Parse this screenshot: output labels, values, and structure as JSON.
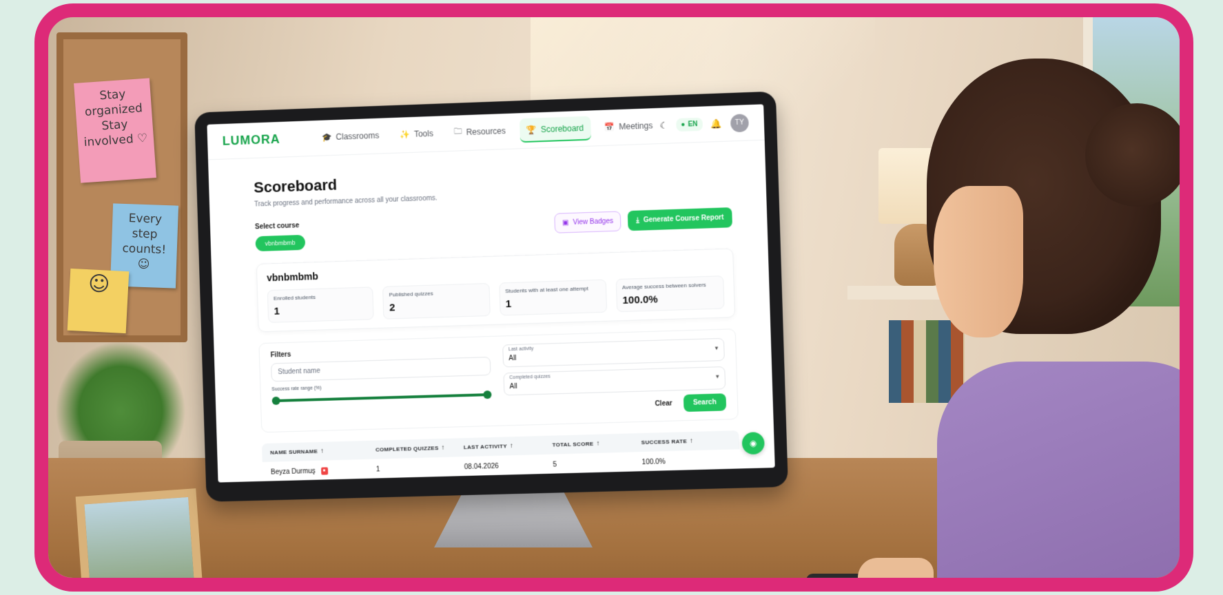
{
  "notes": {
    "pink": "Stay organized Stay involved ♡",
    "blue": "Every step counts! ☺",
    "yellow": "☺"
  },
  "app": {
    "logo": "LUMORA",
    "nav": [
      {
        "label": "Classrooms",
        "icon": "graduation-cap-icon",
        "glyph": "🎓"
      },
      {
        "label": "Tools",
        "icon": "magic-wand-icon",
        "glyph": "✨"
      },
      {
        "label": "Resources",
        "icon": "folder-icon",
        "glyph": "🗀"
      },
      {
        "label": "Scoreboard",
        "icon": "trophy-icon",
        "glyph": "🏆",
        "active": true
      },
      {
        "label": "Meetings",
        "icon": "calendar-icon",
        "glyph": "📅"
      }
    ],
    "lang": "EN",
    "avatar_initials": "TY"
  },
  "page": {
    "title": "Scoreboard",
    "subtitle": "Track progress and performance across all your classrooms.",
    "select_course_label": "Select course",
    "selected_course": "vbnbmbmb",
    "view_badges": "View Badges",
    "generate_report": "Generate Course Report"
  },
  "course": {
    "name": "vbnbmbmb",
    "stats": [
      {
        "label": "Enrolled students",
        "value": "1"
      },
      {
        "label": "Published quizzes",
        "value": "2"
      },
      {
        "label": "Students with at least one attempt",
        "value": "1"
      },
      {
        "label": "Average success between solvers",
        "value": "100.0%"
      }
    ]
  },
  "filters": {
    "title": "Filters",
    "student_placeholder": "Student name",
    "last_activity_label": "Last activity",
    "last_activity_value": "All",
    "completed_quizzes_label": "Completed quizzes",
    "completed_quizzes_value": "All",
    "success_range_label": "Success rate range (%)",
    "success_range_min": 0,
    "success_range_max": 100,
    "clear": "Clear",
    "search": "Search"
  },
  "table": {
    "headers": [
      "NAME SURNAME",
      "COMPLETED QUIZZES",
      "LAST ACTIVITY",
      "TOTAL SCORE",
      "SUCCESS RATE"
    ],
    "rows": [
      {
        "name": "Beyza Durmuş",
        "completed": "1",
        "last_activity": "08.04.2026",
        "total_score": "5",
        "success_rate": "100.0%"
      }
    ]
  },
  "colors": {
    "accent": "#22c55e",
    "frame": "#dd2a78",
    "badge_purple": "#9333ea"
  }
}
